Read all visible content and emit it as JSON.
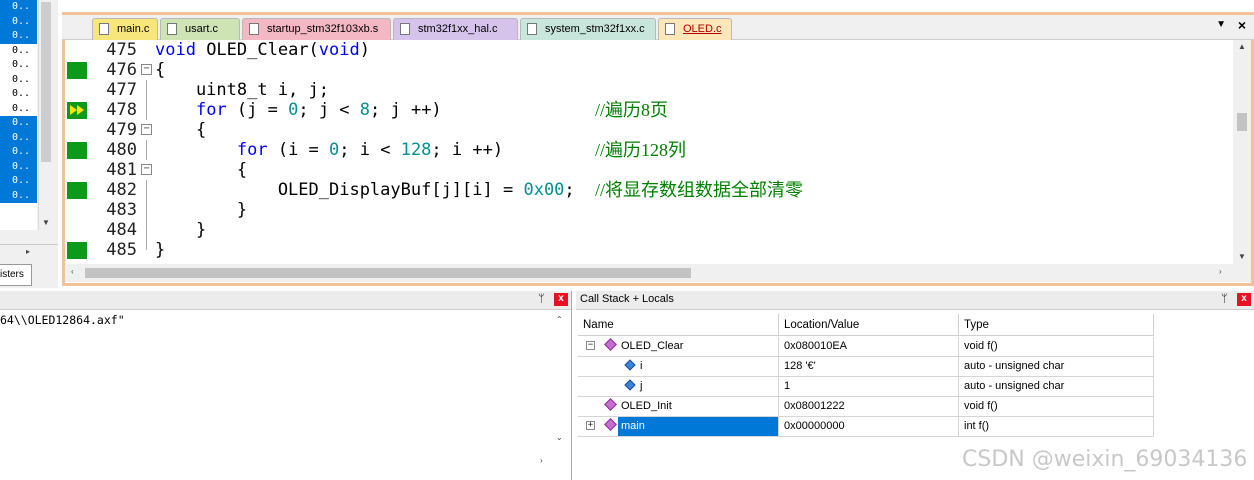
{
  "registers": {
    "rows": [
      "0..",
      "0..",
      "0..",
      "0..",
      "0..",
      "0..",
      "0..",
      "0..",
      "0..",
      "0..",
      "0..",
      "0..",
      "0..",
      "0.."
    ],
    "selected": [
      true,
      true,
      true,
      false,
      false,
      false,
      false,
      false,
      true,
      true,
      true,
      true,
      true,
      true
    ],
    "tab_label": "isters"
  },
  "editor": {
    "tabs": [
      {
        "label": "main.c",
        "color": "#f6e67c"
      },
      {
        "label": "usart.c",
        "color": "#cfe4b4"
      },
      {
        "label": "startup_stm32f103xb.s",
        "color": "#f3b8c4"
      },
      {
        "label": "stm32f1xx_hal.c",
        "color": "#d6c3ec"
      },
      {
        "label": "system_stm32f1xx.c",
        "color": "#c9e6dd"
      },
      {
        "label": "OLED.c",
        "color": "#fde6b8"
      }
    ],
    "active_tab": "OLED.c",
    "menu_glyph": "▼",
    "close_glyph": "×",
    "lines": [
      {
        "num": "475",
        "code": "void OLED_Clear(void)",
        "comment": ""
      },
      {
        "num": "476",
        "code": "{",
        "comment": ""
      },
      {
        "num": "477",
        "code": "    uint8_t i, j;",
        "comment": ""
      },
      {
        "num": "478",
        "code": "    for (j = 0; j < 8; j ++)",
        "comment": "//遍历8页"
      },
      {
        "num": "479",
        "code": "    {",
        "comment": ""
      },
      {
        "num": "480",
        "code": "        for (i = 0; i < 128; i ++)",
        "comment": "//遍历128列"
      },
      {
        "num": "481",
        "code": "        {",
        "comment": ""
      },
      {
        "num": "482",
        "code": "            OLED_DisplayBuf[j][i] = 0x00;",
        "comment": "//将显存数组数据全部清零"
      },
      {
        "num": "483",
        "code": "        }",
        "comment": ""
      },
      {
        "num": "484",
        "code": "    }",
        "comment": ""
      },
      {
        "num": "485",
        "code": "}",
        "comment": ""
      }
    ]
  },
  "build_output": {
    "text": "64\\\\OLED12864.axf\""
  },
  "call_stack": {
    "title": "Call Stack + Locals",
    "pin_glyph": "ᛘ",
    "close_glyph": "x",
    "columns": [
      "Name",
      "Location/Value",
      "Type"
    ],
    "rows": [
      {
        "name": "OLED_Clear",
        "value": "0x080010EA",
        "type": "void f()",
        "expander": "−",
        "kind": "function",
        "selected": false
      },
      {
        "name": "i",
        "value": "128 '€'",
        "type": "auto - unsigned char",
        "expander": "",
        "kind": "variable",
        "selected": false
      },
      {
        "name": "j",
        "value": "1",
        "type": "auto - unsigned char",
        "expander": "",
        "kind": "variable",
        "selected": false
      },
      {
        "name": "OLED_Init",
        "value": "0x08001222",
        "type": "void f()",
        "expander": "",
        "kind": "function",
        "selected": false
      },
      {
        "name": "main",
        "value": "0x00000000",
        "type": "int f()",
        "expander": "+",
        "kind": "function",
        "selected": true
      }
    ]
  },
  "watermark": "CSDN @weixin_69034136"
}
